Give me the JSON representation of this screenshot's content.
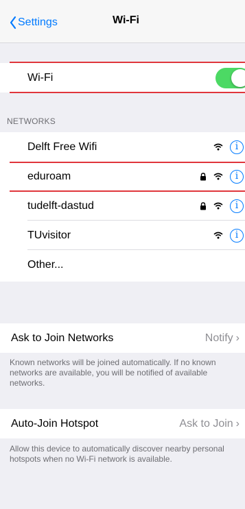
{
  "nav": {
    "back_label": "Settings",
    "title": "Wi-Fi"
  },
  "wifi_toggle": {
    "label": "Wi-Fi",
    "enabled": true,
    "on_color": "#4cd964"
  },
  "networks": {
    "header": "NETWORKS",
    "items": [
      {
        "name": "Delft Free Wifi",
        "secured": false
      },
      {
        "name": "eduroam",
        "secured": true
      },
      {
        "name": "tudelft-dastud",
        "secured": true
      },
      {
        "name": "TUvisitor",
        "secured": false
      }
    ],
    "other_label": "Other..."
  },
  "ask_to_join": {
    "label": "Ask to Join Networks",
    "value": "Notify",
    "footnote": "Known networks will be joined automatically. If no known networks are available, you will be notified of available networks."
  },
  "auto_join_hotspot": {
    "label": "Auto-Join Hotspot",
    "value": "Ask to Join",
    "footnote": "Allow this device to automatically discover nearby personal hotspots when no Wi-Fi network is available."
  },
  "colors": {
    "accent": "#007aff",
    "highlight": "#e0353b",
    "background": "#efeff4"
  },
  "icons": {
    "back": "chevron-left-icon",
    "wifi": "wifi-icon",
    "lock": "lock-icon",
    "info": "info-icon"
  }
}
